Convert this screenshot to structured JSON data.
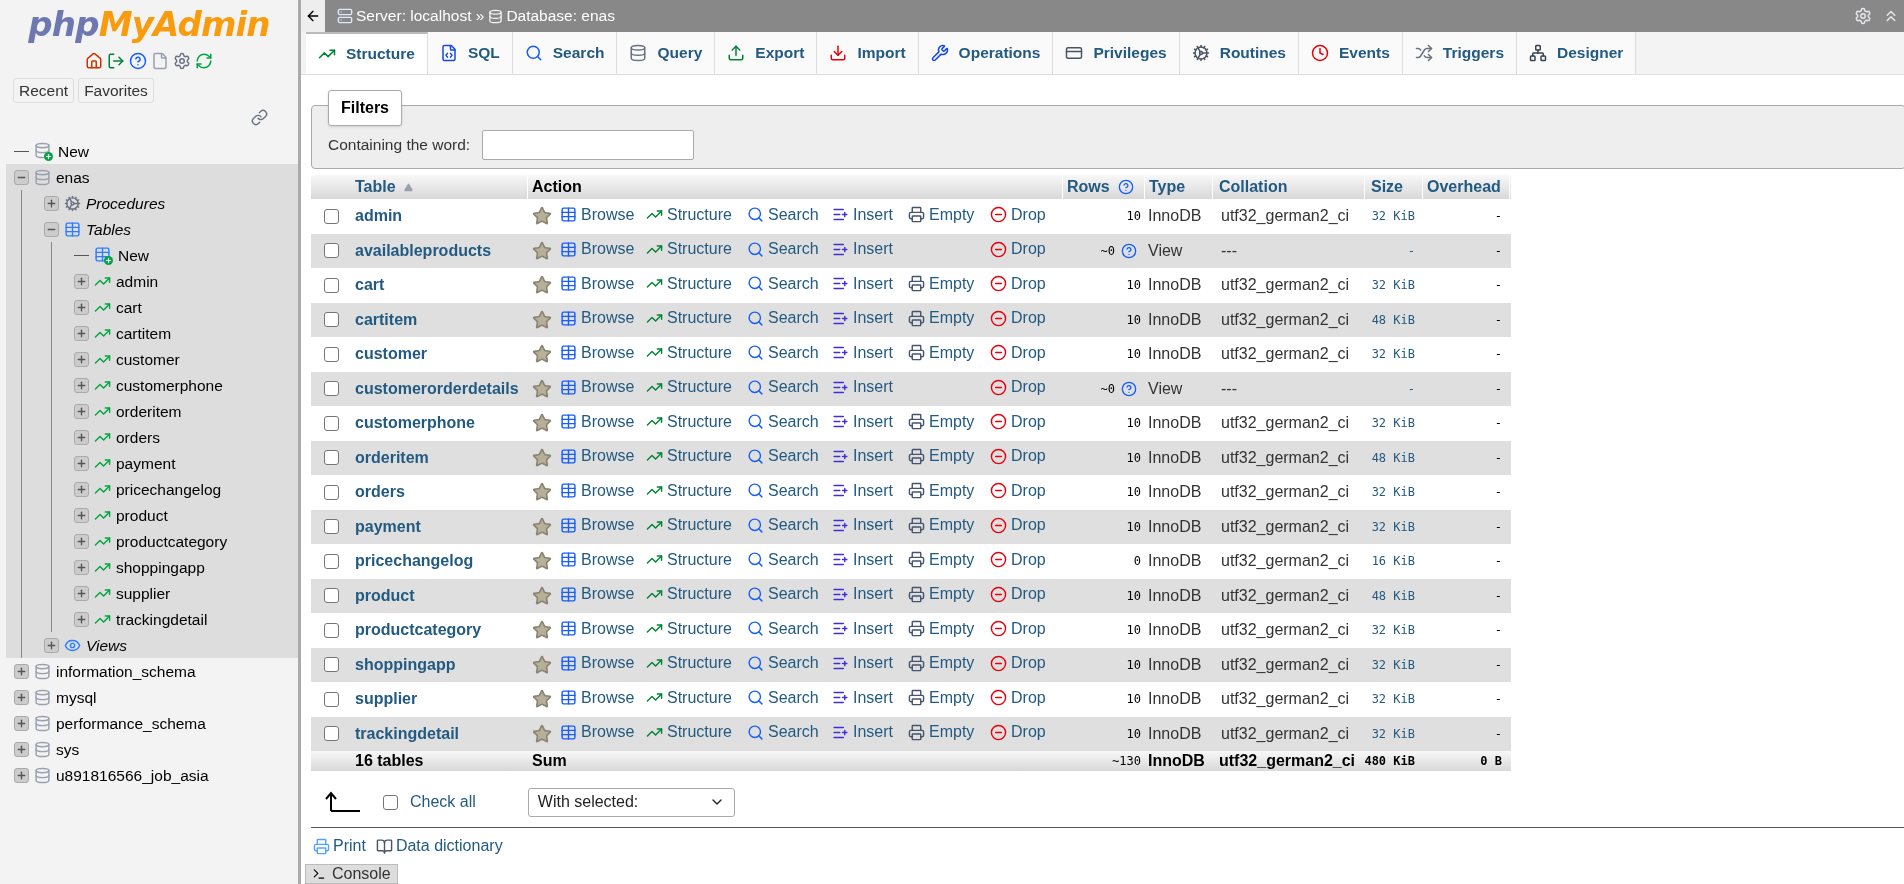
{
  "sidebar": {
    "logo": {
      "first": "php",
      "second": "MyAdmin"
    },
    "buttons": [
      "Recent",
      "Favorites"
    ],
    "tree": [
      {
        "label": "New",
        "kind": "new",
        "selected": false
      },
      {
        "label": "enas",
        "kind": "database",
        "expanded": true,
        "selected": true,
        "children": [
          {
            "label": "Procedures",
            "kind": "procedures",
            "expanded": false
          },
          {
            "label": "Tables",
            "kind": "tables",
            "expanded": true,
            "children": [
              {
                "label": "New",
                "kind": "new-table"
              },
              {
                "label": "admin",
                "kind": "table",
                "expanded": false
              },
              {
                "label": "cart",
                "kind": "table",
                "expanded": false
              },
              {
                "label": "cartitem",
                "kind": "table",
                "expanded": false
              },
              {
                "label": "customer",
                "kind": "table",
                "expanded": false
              },
              {
                "label": "customerphone",
                "kind": "table",
                "expanded": false
              },
              {
                "label": "orderitem",
                "kind": "table",
                "expanded": false
              },
              {
                "label": "orders",
                "kind": "table",
                "expanded": false
              },
              {
                "label": "payment",
                "kind": "table",
                "expanded": false
              },
              {
                "label": "pricechangelog",
                "kind": "table",
                "expanded": false
              },
              {
                "label": "product",
                "kind": "table",
                "expanded": false
              },
              {
                "label": "productcategory",
                "kind": "table",
                "expanded": false
              },
              {
                "label": "shoppingapp",
                "kind": "table",
                "expanded": false
              },
              {
                "label": "supplier",
                "kind": "table",
                "expanded": false
              },
              {
                "label": "trackingdetail",
                "kind": "table",
                "expanded": false
              }
            ]
          },
          {
            "label": "Views",
            "kind": "views",
            "expanded": false
          }
        ]
      },
      {
        "label": "information_schema",
        "kind": "database",
        "expanded": false,
        "selected": false
      },
      {
        "label": "mysql",
        "kind": "database",
        "expanded": false,
        "selected": false
      },
      {
        "label": "performance_schema",
        "kind": "database",
        "expanded": false,
        "selected": false
      },
      {
        "label": "sys",
        "kind": "database",
        "expanded": false,
        "selected": false
      },
      {
        "label": "u891816566_job_asia",
        "kind": "database",
        "expanded": false,
        "selected": false
      }
    ]
  },
  "breadcrumb": {
    "server": "Server: localhost »",
    "database": "Database: enas"
  },
  "tabs": [
    {
      "label": "Structure",
      "kind": "structure",
      "selected": true
    },
    {
      "label": "SQL",
      "kind": "sql",
      "selected": false
    },
    {
      "label": "Search",
      "kind": "search",
      "selected": false
    },
    {
      "label": "Query",
      "kind": "query",
      "selected": false
    },
    {
      "label": "Export",
      "kind": "export",
      "selected": false
    },
    {
      "label": "Import",
      "kind": "import",
      "selected": false
    },
    {
      "label": "Operations",
      "kind": "operations",
      "selected": false
    },
    {
      "label": "Privileges",
      "kind": "privileges",
      "selected": false
    },
    {
      "label": "Routines",
      "kind": "routines",
      "selected": false
    },
    {
      "label": "Events",
      "kind": "events",
      "selected": false
    },
    {
      "label": "Triggers",
      "kind": "triggers",
      "selected": false
    },
    {
      "label": "Designer",
      "kind": "designer",
      "selected": false
    }
  ],
  "filters": {
    "title": "Filters",
    "label": "Containing the word:"
  },
  "table": {
    "columns": [
      {
        "label": "Table",
        "sortable": true,
        "sorted": true,
        "help": false
      },
      {
        "label": "Action",
        "sortable": false,
        "sorted": false,
        "help": false
      },
      {
        "label": "Rows",
        "sortable": true,
        "sorted": false,
        "help": true
      },
      {
        "label": "Type",
        "sortable": true,
        "sorted": false,
        "help": false
      },
      {
        "label": "Collation",
        "sortable": true,
        "sorted": false,
        "help": false
      },
      {
        "label": "Size",
        "sortable": true,
        "sorted": false,
        "help": false
      },
      {
        "label": "Overhead",
        "sortable": true,
        "sorted": false,
        "help": false
      }
    ],
    "rows": [
      {
        "name": "admin",
        "kind": "table",
        "checked": false,
        "actions": [
          "Browse",
          "Structure",
          "Search",
          "Insert",
          "Empty",
          "Drop"
        ],
        "rows": "10",
        "type": "InnoDB",
        "collation": "utf32_german2_ci",
        "size": "32 KiB",
        "overhead": "-"
      },
      {
        "name": "availableproducts",
        "kind": "view",
        "checked": false,
        "actions": [
          "Browse",
          "Structure",
          "Search",
          "Insert",
          "Drop"
        ],
        "rows": "~0",
        "type": "View",
        "collation": "---",
        "size": "-",
        "overhead": "-"
      },
      {
        "name": "cart",
        "kind": "table",
        "checked": false,
        "actions": [
          "Browse",
          "Structure",
          "Search",
          "Insert",
          "Empty",
          "Drop"
        ],
        "rows": "10",
        "type": "InnoDB",
        "collation": "utf32_german2_ci",
        "size": "32 KiB",
        "overhead": "-"
      },
      {
        "name": "cartitem",
        "kind": "table",
        "checked": false,
        "actions": [
          "Browse",
          "Structure",
          "Search",
          "Insert",
          "Empty",
          "Drop"
        ],
        "rows": "10",
        "type": "InnoDB",
        "collation": "utf32_german2_ci",
        "size": "48 KiB",
        "overhead": "-"
      },
      {
        "name": "customer",
        "kind": "table",
        "checked": false,
        "actions": [
          "Browse",
          "Structure",
          "Search",
          "Insert",
          "Empty",
          "Drop"
        ],
        "rows": "10",
        "type": "InnoDB",
        "collation": "utf32_german2_ci",
        "size": "32 KiB",
        "overhead": "-"
      },
      {
        "name": "customerorderdetails",
        "kind": "view",
        "checked": false,
        "actions": [
          "Browse",
          "Structure",
          "Search",
          "Insert",
          "Drop"
        ],
        "rows": "~0",
        "type": "View",
        "collation": "---",
        "size": "-",
        "overhead": "-"
      },
      {
        "name": "customerphone",
        "kind": "table",
        "checked": false,
        "actions": [
          "Browse",
          "Structure",
          "Search",
          "Insert",
          "Empty",
          "Drop"
        ],
        "rows": "10",
        "type": "InnoDB",
        "collation": "utf32_german2_ci",
        "size": "32 KiB",
        "overhead": "-"
      },
      {
        "name": "orderitem",
        "kind": "table",
        "checked": false,
        "actions": [
          "Browse",
          "Structure",
          "Search",
          "Insert",
          "Empty",
          "Drop"
        ],
        "rows": "10",
        "type": "InnoDB",
        "collation": "utf32_german2_ci",
        "size": "48 KiB",
        "overhead": "-"
      },
      {
        "name": "orders",
        "kind": "table",
        "checked": false,
        "actions": [
          "Browse",
          "Structure",
          "Search",
          "Insert",
          "Empty",
          "Drop"
        ],
        "rows": "10",
        "type": "InnoDB",
        "collation": "utf32_german2_ci",
        "size": "32 KiB",
        "overhead": "-"
      },
      {
        "name": "payment",
        "kind": "table",
        "checked": false,
        "actions": [
          "Browse",
          "Structure",
          "Search",
          "Insert",
          "Empty",
          "Drop"
        ],
        "rows": "10",
        "type": "InnoDB",
        "collation": "utf32_german2_ci",
        "size": "32 KiB",
        "overhead": "-"
      },
      {
        "name": "pricechangelog",
        "kind": "table",
        "checked": false,
        "actions": [
          "Browse",
          "Structure",
          "Search",
          "Insert",
          "Empty",
          "Drop"
        ],
        "rows": "0",
        "type": "InnoDB",
        "collation": "utf32_german2_ci",
        "size": "16 KiB",
        "overhead": "-"
      },
      {
        "name": "product",
        "kind": "table",
        "checked": false,
        "actions": [
          "Browse",
          "Structure",
          "Search",
          "Insert",
          "Empty",
          "Drop"
        ],
        "rows": "10",
        "type": "InnoDB",
        "collation": "utf32_german2_ci",
        "size": "48 KiB",
        "overhead": "-"
      },
      {
        "name": "productcategory",
        "kind": "table",
        "checked": false,
        "actions": [
          "Browse",
          "Structure",
          "Search",
          "Insert",
          "Empty",
          "Drop"
        ],
        "rows": "10",
        "type": "InnoDB",
        "collation": "utf32_german2_ci",
        "size": "32 KiB",
        "overhead": "-"
      },
      {
        "name": "shoppingapp",
        "kind": "table",
        "checked": false,
        "actions": [
          "Browse",
          "Structure",
          "Search",
          "Insert",
          "Empty",
          "Drop"
        ],
        "rows": "10",
        "type": "InnoDB",
        "collation": "utf32_german2_ci",
        "size": "32 KiB",
        "overhead": "-"
      },
      {
        "name": "supplier",
        "kind": "table",
        "checked": false,
        "actions": [
          "Browse",
          "Structure",
          "Search",
          "Insert",
          "Empty",
          "Drop"
        ],
        "rows": "10",
        "type": "InnoDB",
        "collation": "utf32_german2_ci",
        "size": "32 KiB",
        "overhead": "-"
      },
      {
        "name": "trackingdetail",
        "kind": "table",
        "checked": false,
        "actions": [
          "Browse",
          "Structure",
          "Search",
          "Insert",
          "Empty",
          "Drop"
        ],
        "rows": "10",
        "type": "InnoDB",
        "collation": "utf32_german2_ci",
        "size": "32 KiB",
        "overhead": "-"
      }
    ],
    "summary": {
      "name": "16 tables",
      "action": "Sum",
      "rows": "~130",
      "type": "InnoDB",
      "collation": "utf32_german2_ci",
      "size": "480 KiB",
      "overhead": "0 B"
    }
  },
  "footer": {
    "check_all": {
      "label": "Check all",
      "checked": false
    },
    "with_selected": "With selected:",
    "links": [
      "Print",
      "Data dictionary"
    ]
  },
  "console": "Console"
}
